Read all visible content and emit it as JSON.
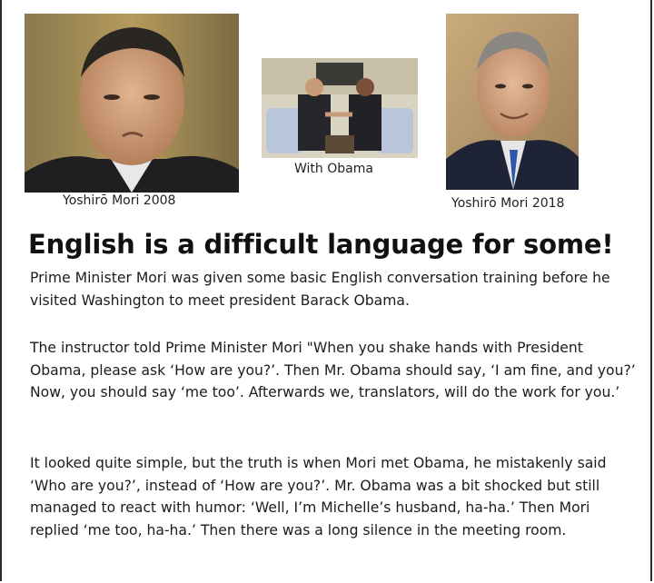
{
  "photos": {
    "left": {
      "caption": "Yoshirō Mori 2008"
    },
    "middle": {
      "caption": "With Obama"
    },
    "right": {
      "caption": "Yoshirō Mori 2018"
    }
  },
  "headline": "English is a difficult language for some!",
  "paragraphs": [
    "Prime Minister Mori was given some basic English conversation training before he visited Washington to meet president Barack Obama.",
    "The instructor told Prime Minister Mori \"When you shake hands with President Obama, please ask ‘How are you?’. Then Mr. Obama should say, ‘I am fine, and you?’ Now, you should say ‘me too’. Afterwards we, translators, will do the work for you.’",
    "It looked quite simple, but the truth is when Mori met Obama, he mistakenly said ‘Who are you?’, instead of ‘How are you?’. Mr. Obama was a bit shocked but still managed to react with humor: ‘Well, I’m Michelle’s husband, ha-ha.’ Then Mori replied ‘me too, ha-ha.’ Then there was a long silence in the meeting room."
  ]
}
